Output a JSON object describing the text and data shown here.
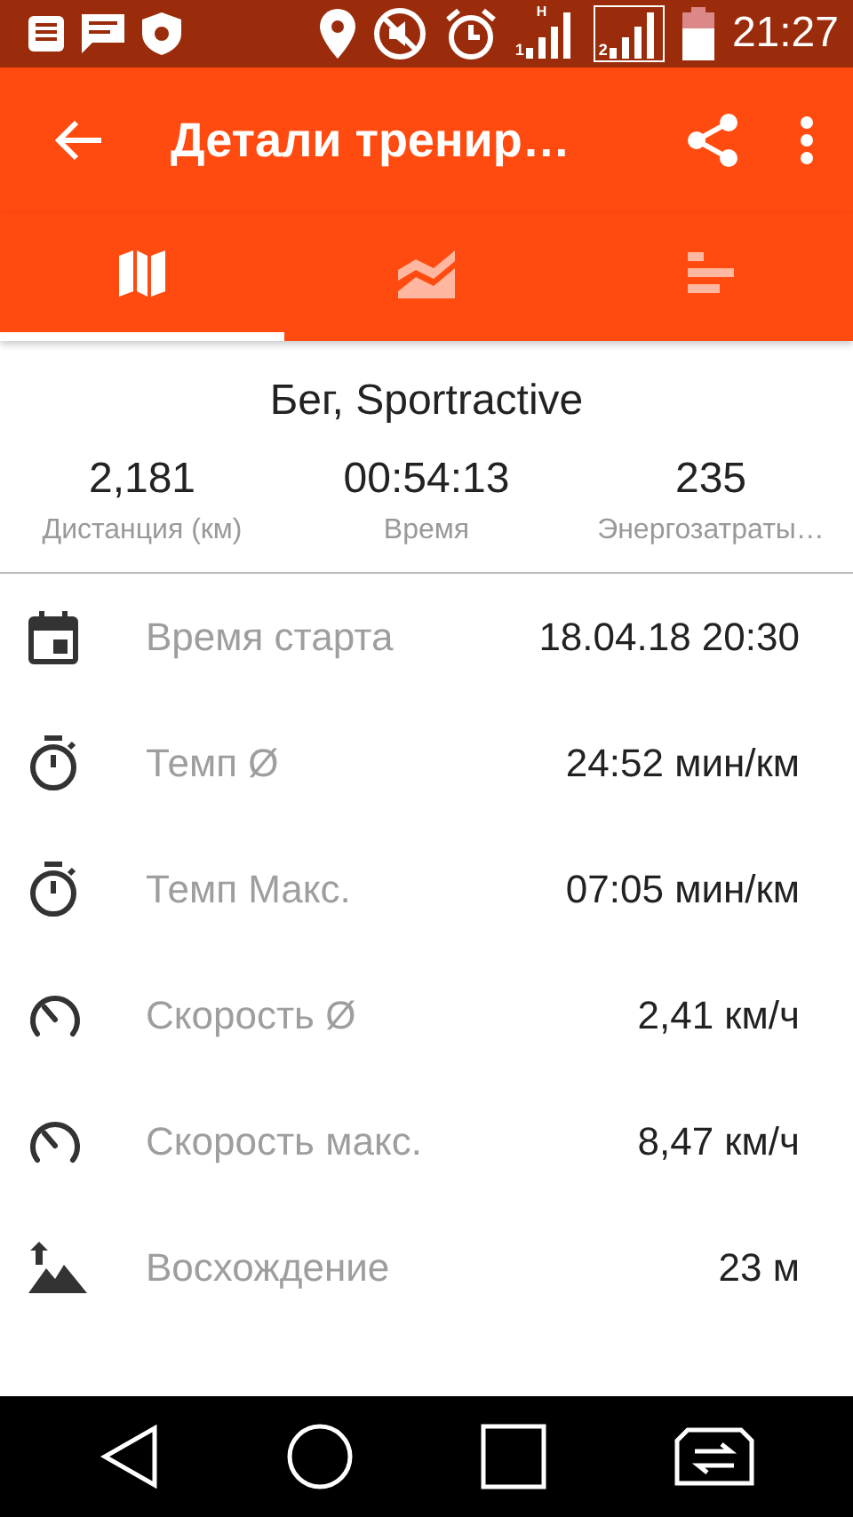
{
  "status_bar": {
    "sim_1": "1",
    "network": "H",
    "sim_2": "2",
    "time": "21:27"
  },
  "app_bar": {
    "title": "Детали тренир…"
  },
  "tabs": [
    {
      "kind": "map",
      "selected": true
    },
    {
      "kind": "graph",
      "selected": false
    },
    {
      "kind": "bars",
      "selected": false
    }
  ],
  "summary": {
    "title": "Бег, Sportractive",
    "stats": [
      {
        "value": "2,181",
        "label": "Дистанция (км)"
      },
      {
        "value": "00:54:13",
        "label": "Время"
      },
      {
        "value": "235",
        "label": "Энергозатраты…"
      }
    ]
  },
  "details": [
    {
      "kind": "calendar",
      "label": "Время старта",
      "value": "18.04.18 20:30"
    },
    {
      "kind": "stopwatch",
      "label": "Темп Ø",
      "value": "24:52 мин/км"
    },
    {
      "kind": "stopwatch",
      "label": "Темп Макс.",
      "value": "07:05 мин/км"
    },
    {
      "kind": "speedometer",
      "label": "Скорость Ø",
      "value": "2,41 км/ч"
    },
    {
      "kind": "speedometer",
      "label": "Скорость макс.",
      "value": "8,47 км/ч"
    },
    {
      "kind": "climb",
      "label": "Восхождение",
      "value": "23 м"
    }
  ]
}
